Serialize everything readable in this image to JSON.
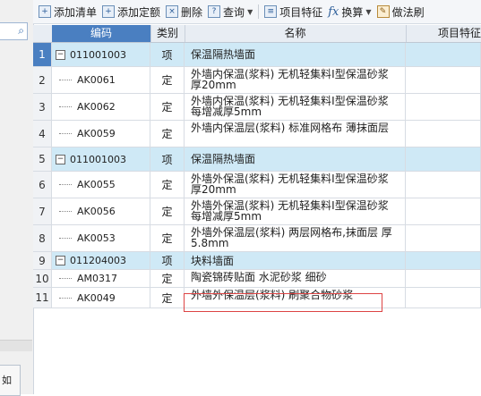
{
  "toolbar": {
    "add_list": "添加清单",
    "add_quota": "添加定额",
    "delete": "删除",
    "query": "查询",
    "item_feature": "项目特征",
    "convert": "换算",
    "method": "做法刷"
  },
  "grid": {
    "headers": {
      "code": "编码",
      "type": "类别",
      "name": "名称",
      "feature": "项目特征"
    },
    "rows": [
      {
        "idx": "1",
        "code": "011001003",
        "type": "项",
        "name": "保温隔热墙面"
      },
      {
        "idx": "2",
        "code": "AK0061",
        "type": "定",
        "name": "外墙内保温(浆料) 无机轻集料I型保温砂浆 厚20mm"
      },
      {
        "idx": "3",
        "code": "AK0062",
        "type": "定",
        "name": "外墙内保温(浆料) 无机轻集料I型保温砂浆 每增减厚5mm"
      },
      {
        "idx": "4",
        "code": "AK0059",
        "type": "定",
        "name": "外墙内保温层(浆料) 标准网格布 薄抹面层"
      },
      {
        "idx": "5",
        "code": "011001003",
        "type": "项",
        "name": "保温隔热墙面"
      },
      {
        "idx": "6",
        "code": "AK0055",
        "type": "定",
        "name": "外墙外保温(浆料) 无机轻集料I型保温砂浆 厚20mm"
      },
      {
        "idx": "7",
        "code": "AK0056",
        "type": "定",
        "name": "外墙外保温(浆料) 无机轻集料I型保温砂浆 每增减厚5mm"
      },
      {
        "idx": "8",
        "code": "AK0053",
        "type": "定",
        "name": "外墙外保温层(浆料) 两层网格布,抹面层 厚5.8mm"
      },
      {
        "idx": "9",
        "code": "011204003",
        "type": "项",
        "name": "块料墙面"
      },
      {
        "idx": "10",
        "code": "AM0317",
        "type": "定",
        "name": "陶瓷锦砖贴面 水泥砂浆 细砂"
      },
      {
        "idx": "11",
        "code": "AK0049",
        "type": "定",
        "name": "外墙外保温层(浆料) 刷聚合物砂浆"
      }
    ]
  },
  "icons": {
    "search": "search-icon"
  },
  "colors": {
    "header_selected": "#4a7fc1",
    "group_row": "#cfe9f6",
    "highlight": "#dd4444"
  },
  "left_bottom_text": "如"
}
